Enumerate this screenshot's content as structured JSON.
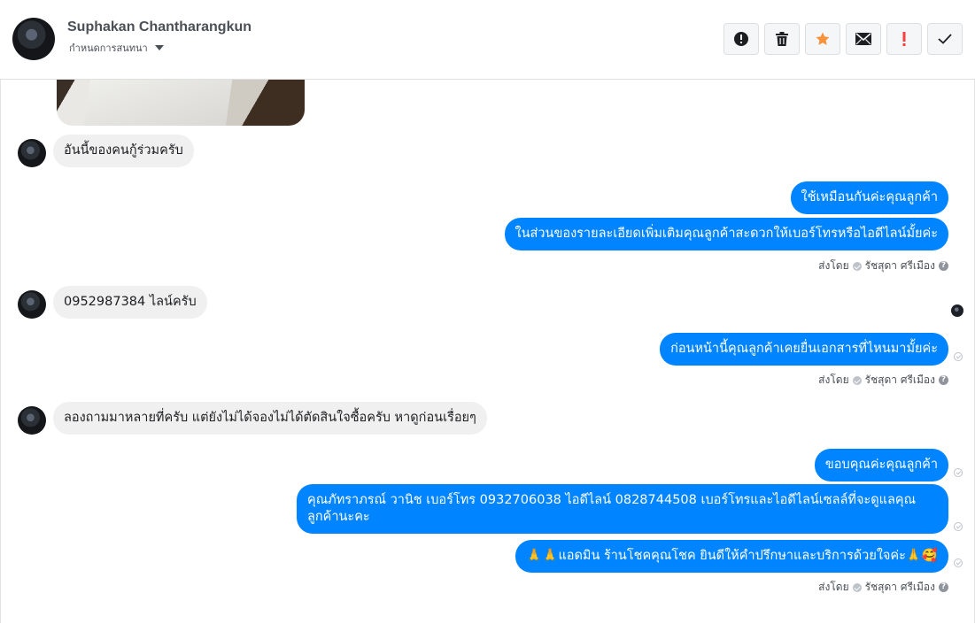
{
  "header": {
    "name": "Suphakan Chantharangkun",
    "subtitle": "กำหนดการสนทนา",
    "actions": [
      "spam-icon",
      "trash-icon",
      "star-icon",
      "mail-icon",
      "important-icon",
      "check-icon"
    ]
  },
  "messages": {
    "in1": "อันนี้ของคนกู้ร่วมครับ",
    "out1": "ใช้เหมือนกันค่ะคุณลูกค้า",
    "out2": "ในส่วนของรายละเอียดเพิ่มเติมคุณลูกค้าสะดวกให้เบอร์โทรหรือไอดีไลน์มั้ยค่ะ",
    "in2": "0952987384 ไลน์ครับ",
    "out3": "ก่อนหน้านี้คุณลูกค้าเคยยื่นเอกสารที่ไหนมามั้ยค่ะ",
    "in3": "ลองถามมาหลายที่ครับ แต่ยังไม่ได้จองไม่ได้ตัดสินใจซื้อครับ หาดูก่อนเรื่อยๆ",
    "out4": "ขอบคุณค่ะคุณลูกค้า",
    "out5": "คุณภัทราภรณ์  วานิช      เบอร์โทร 0932706038  ไอดีไลน์ 0828744508    เบอร์โทรและไอดีไลน์เซลล์ที่จะดูแลคุณลูกค้านะคะ",
    "out6": "🙏🙏แอดมิน ร้านโชคคุณโชค ยินดีให้คำปรึกษาและบริการด้วยใจค่ะ🙏🥰"
  },
  "sent_by": {
    "label": "ส่งโดย",
    "agent": "รัชสุดา ศรีเมือง"
  },
  "colors": {
    "outgoing_bubble": "#0084ff",
    "incoming_bubble": "#f1f0f0",
    "star": "#f7923b",
    "important": "#fa3e3e"
  }
}
